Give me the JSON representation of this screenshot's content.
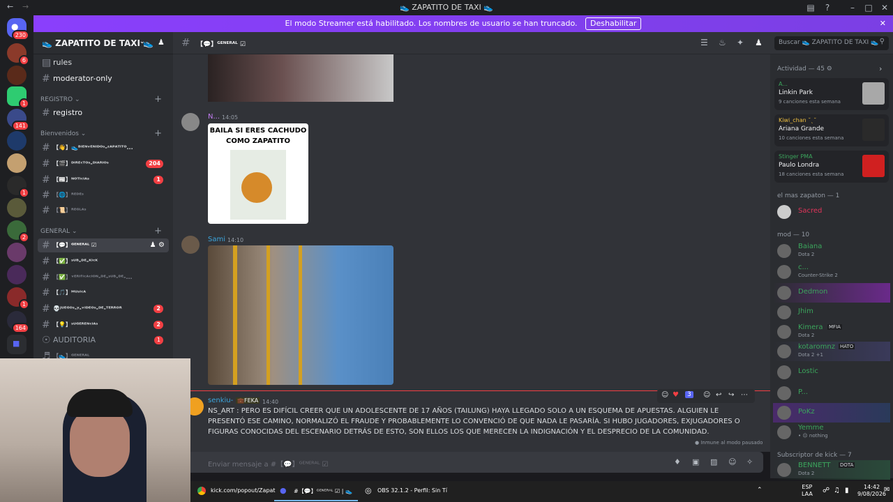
{
  "window": {
    "title": "👟 ZAPATITO DE TAXI 👟"
  },
  "banner": {
    "text": "El modo Streamer está habilitado. Los nombres de usuario se han truncado.",
    "button": "Deshabilitar"
  },
  "servers": {
    "home_badge": "230",
    "badges": [
      "6",
      "1",
      "141",
      "1",
      "2",
      "1",
      "164"
    ]
  },
  "sidebar": {
    "server_name": "👟 ZAPATITO DE TAXI 👟",
    "top_channels": [
      "rules",
      "moderator-only"
    ],
    "cat_registro": "REGISTRO",
    "registro_channels": [
      "registro"
    ],
    "cat_bienvenidos": "Bienvenidos",
    "bienvenidos_channels": [
      {
        "label": "【👋】👟ᴮᴵᴱᴺᵛᴱᴺᴵᴰᴼˢ-ᶻᴬᴾᴬᵀᴵᵀᴼ...",
        "badge": ""
      },
      {
        "label": "【🎬】ᴰᴵᴿᴱᶜᵀᴼˢ-ᴰᴵᴬᴿᴵᴼˢ",
        "badge": "204"
      },
      {
        "label": "【📰】ᴺᴼᵀᴵᶜᴵᴬˢ",
        "badge": "1"
      },
      {
        "label": "【🌐】ᴿᴱᴰᴱˢ",
        "badge": ""
      },
      {
        "label": "【📜】ᴿᴱᴳᴸᴬˢ",
        "badge": ""
      }
    ],
    "cat_general": "GENERAL",
    "general_channels": [
      {
        "label": "【💬】ᴳᴱᴺᴱᴿᴬᴸ ☑",
        "badge": ""
      },
      {
        "label": "【✅】ˢᵁᴮ-ᴰᴱ-ᴷᴵᶜᴷ",
        "badge": ""
      },
      {
        "label": "【✅】ᵛᴱᴿᴵᶠᴵᶜᴬᶜᴵᴼᴺ-ᴰᴱ-ˢᵁᴮ-ᴰᴱ-...",
        "badge": ""
      },
      {
        "label": "【🎵】ᴹᵁˢᴵᶜᴬ",
        "badge": ""
      },
      {
        "label": "💀ᴶᵁᴱᴳᴼˢ-ʸ-ᵛᴵᴰᴱᴼˢ-ᴰᴱ-ᵀᴱᴿᴿᴼᴿ",
        "badge": "2"
      },
      {
        "label": "【💡】ˢᵁᴳᴱᴿᴱᴺᶜᴵᴬˢ",
        "badge": "2"
      }
    ],
    "auditoria": {
      "label": "AUDITORIA",
      "badge": "1"
    },
    "voice_general": "【👟】ᴳᴱᴺᴱᴿᴬᴸ"
  },
  "header": {
    "channel": "【💬】ᴳᴱᴺᴱᴿᴬᴸ ☑",
    "search_placeholder": "Buscar 👟 ZAPATITO DE TAXI 👟"
  },
  "messages": [
    {
      "user": "N...",
      "time": "14:05",
      "caption": "BAILA SI ERES CACHUDO COMO ZAPATITO"
    },
    {
      "user": "Sami",
      "time": "14:10"
    },
    {
      "user": "senkiu-",
      "tag": "💼FEKA",
      "time": "14:40",
      "text": "NS_ART : PERO ES DIFÍCIL CREER QUE UN ADOLESCENTE DE 17 AÑOS (TAILUNG) HAYA LLEGADO SOLO A UN ESQUEMA DE APUESTAS. ALGUIEN LE PRESENTÓ ESE CAMINO, NORMALIZÓ EL FRAUDE Y PROBABLEMENTE LO CONVENCIÓ DE QUE NADA LE PASARÍA. SI HUBO JUGADORES, EXJUGADORES O FIGURAS CONOCIDAS DEL ESCENARIO DETRÁS DE ESTO, SON ELLOS LOS QUE MERECEN LA INDIGNACIÓN Y EL DESPRECIO DE LA COMUNIDAD.",
      "reaction_count": "3"
    }
  ],
  "paused": "Inmune al modo pausado",
  "input": {
    "placeholder": "Enviar mensaje a #【💬】ᴳᴱᴺᴱᴿᴬᴸ ☑"
  },
  "members": {
    "activity_title": "Actividad — 45",
    "activity": [
      {
        "user": "A...",
        "title": "Linkin Park",
        "sub": "9 canciones esta semana"
      },
      {
        "user": "Kiwi_chan ˘ˎ˘",
        "title": "Ariana Grande",
        "sub": "10 canciones esta semana"
      },
      {
        "user": "Stinger PMA",
        "title": "Paulo Londra",
        "sub": "18 canciones esta semana"
      }
    ],
    "cat1": "el mas zapaton — 1",
    "cat1_members": [
      {
        "name": "Sacred",
        "sub": "",
        "color": "#e2345a"
      }
    ],
    "cat2": "mod — 10",
    "cat2_members": [
      {
        "name": "Baiana",
        "sub": "Dota 2",
        "color": "#3ba55c"
      },
      {
        "name": "c...",
        "sub": "Counter-Strike 2",
        "color": "#3ba55c"
      },
      {
        "name": "Dedmon",
        "sub": "",
        "color": "#3ba55c"
      },
      {
        "name": "Jhim",
        "sub": "",
        "color": "#3ba55c"
      },
      {
        "name": "Kimera",
        "tag": "MFIA",
        "sub": "Dota 2",
        "color": "#3ba55c"
      },
      {
        "name": "kotaromnz",
        "tag": "HATO",
        "sub": "Dota 2 +1",
        "color": "#3ba55c"
      },
      {
        "name": "Lostic",
        "sub": "",
        "color": "#3ba55c"
      },
      {
        "name": "P...",
        "sub": "",
        "color": "#3ba55c"
      },
      {
        "name": "PoKz",
        "sub": "",
        "color": "#3ba55c"
      },
      {
        "name": "Yemme",
        "sub": "• 😐 nothing",
        "color": "#3ba55c"
      }
    ],
    "cat3": "Subscriptor de kick — 7",
    "cat3_members": [
      {
        "name": "BENNETT",
        "tag": "DOTA",
        "sub": "Dota 2",
        "color": "#3ba55c"
      }
    ]
  },
  "taskbar": {
    "items": [
      "kick.com/popout/Zapat",
      "#【💬】ᴳᴱᴺᴱᴿᴬᴸ ☑ | 👟 Z",
      "OBS 32.1.2 - Perfil: Sin Tí"
    ],
    "lang": "ESP",
    "lang2": "LAA",
    "time": "14:42",
    "date": "9/08/2026"
  }
}
